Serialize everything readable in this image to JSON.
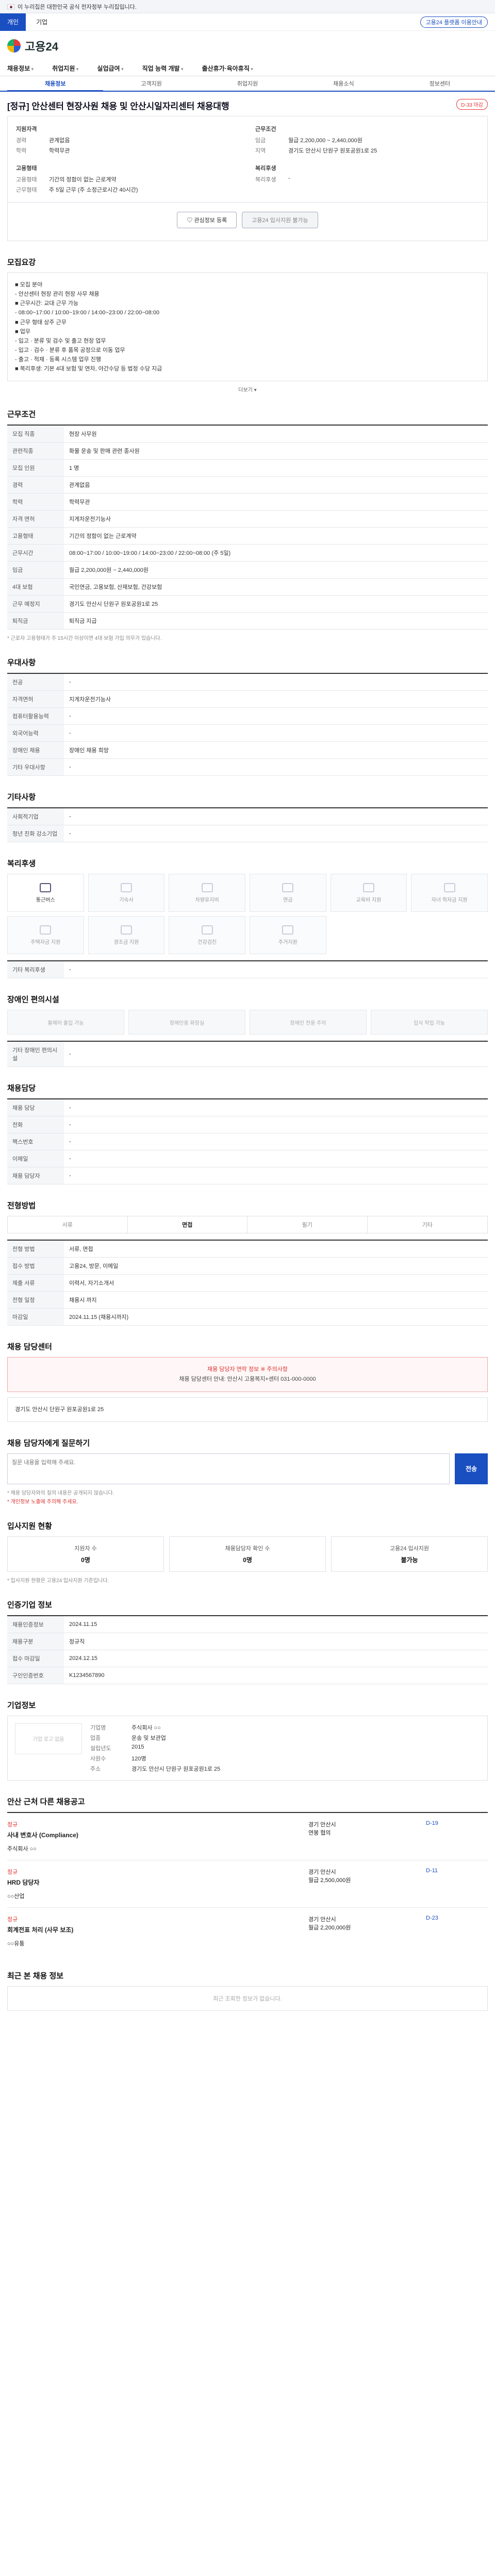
{
  "gov": {
    "text": "이 누리집은 대한민국 공식 전자정부 누리집입니다."
  },
  "top": {
    "personal": "개인",
    "corp": "기업",
    "right_link": "고용24 플랫폼 이용안내"
  },
  "brand": "고용24",
  "gnb": [
    "채용정보",
    "취업지원",
    "실업급여",
    "직업 능력 개발",
    "출산휴가·육아휴직"
  ],
  "tabs": [
    "채용정보",
    "고객지원",
    "취업지원",
    "채용소식",
    "정보센터"
  ],
  "job": {
    "title": "[정규] 안산센터 현장사원 채용 및 안산시일자리센터 채용대행",
    "dday": "D-33 마감"
  },
  "summary": {
    "h1": "지원자격",
    "h2": "근무조건",
    "h3": "고용형태",
    "h4": "복리후생",
    "rows1": [
      [
        "경력",
        "관계없음"
      ],
      [
        "학력",
        "학력무관"
      ]
    ],
    "rows2": [
      [
        "임금",
        "월급 2,200,000 ~ 2,440,000원"
      ],
      [
        "지역",
        "경기도 안산시 단원구 원포공원1로 25"
      ]
    ],
    "rows3": [
      [
        "고용형태",
        "기간의 정함이 없는 근로계약"
      ],
      [
        "근무형태",
        "주 5일 근무 (주 소정근로시간 40시간)"
      ]
    ],
    "rows4": [
      [
        "복리후생",
        "-"
      ]
    ]
  },
  "buttons": {
    "fav": "관심정보 등록",
    "apply": "고용24 입사지원 불가능"
  },
  "s_job": {
    "h": "모집요강",
    "lines": [
      "■ 모집 분야",
      "- 안산센터 현장 관리 현장 사무 채용",
      "■ 근무시간: 교대 근무 가능",
      "- 08:00~17:00 / 10:00~19:00 / 14:00~23:00 / 22:00~08:00",
      "■ 근무 형태 상주 근무",
      "■ 업무",
      "- 입고 · 분류 및 검수 및 출고 현장 업무",
      "- 입고 · 검수 · 분류 후 품목 공정으로 이동 업무",
      "- 출고 · 적재 · 등록 시스템 업무 진행",
      "■ 복리후생: 기본 4대 보험 및 연차, 야간수당 등 법정 수당 지급"
    ],
    "more": "더보기 ▾"
  },
  "s_cond": {
    "h": "근무조건",
    "rows": [
      [
        "모집 직종",
        "현장 사무원"
      ],
      [
        "관련직종",
        "화물 운송 및 판매 관련 종사원"
      ],
      [
        "모집 인원",
        "1 명"
      ],
      [
        "경력",
        "관계없음"
      ],
      [
        "학력",
        "학력무관"
      ],
      [
        "자격 면허",
        "지게차운전기능사"
      ],
      [
        "고용형태",
        "기간의 정함이 없는 근로계약"
      ],
      [
        "근무시간",
        "08:00~17:00 / 10:00~19:00 / 14:00~23:00 / 22:00~08:00 (주 5일)"
      ],
      [
        "임금",
        "월급 2,200,000원 ~ 2,440,000원"
      ],
      [
        "4대 보험",
        "국민연금, 고용보험, 산재보험, 건강보험"
      ],
      [
        "근무 예정지",
        "경기도 안산시 단원구 원포공원1로 25"
      ],
      [
        "퇴직금",
        "퇴직금 지급"
      ]
    ],
    "note": "* 근로자 고용형태가 주 15시간 이상이면 4대 보험 가입 의무가 있습니다."
  },
  "s_cert": {
    "h": "우대사항",
    "rows": [
      [
        "전공",
        "-"
      ],
      [
        "자격면허",
        "지게차운전기능사"
      ],
      [
        "컴퓨터활용능력",
        "-"
      ],
      [
        "외국어능력",
        "-"
      ],
      [
        "장애인 채용",
        "장애인 채용 희망"
      ],
      [
        "기타 우대사항",
        "-"
      ]
    ]
  },
  "s_etc": {
    "h": "기타사항",
    "rows": [
      [
        "사회적기업",
        "-"
      ],
      [
        "청년 친화 강소기업",
        "-"
      ]
    ]
  },
  "s_welfare": {
    "h": "복리후생",
    "items": [
      "통근버스",
      "기숙사",
      "차량유지비",
      "연금",
      "교육비 지원",
      "자녀 학자금 지원",
      "주택자금 지원",
      "경조금 지원",
      "건강검진",
      "주거지원"
    ],
    "extra": "기타 복리후생",
    "extra_val": "-"
  },
  "s_disab": {
    "h": "장애인 편의시설",
    "items": [
      "휠체어 출입 가능",
      "장애인용 화장실",
      "장애인 전용 주차",
      "입식 작업 가능"
    ],
    "extra": "기타 장애인 편의시설",
    "extra_val": "-"
  },
  "s_contact": {
    "h": "채용담당",
    "rows": [
      [
        "채용 담당",
        "-"
      ],
      [
        "전화",
        "-"
      ],
      [
        "팩스번호",
        "-"
      ],
      [
        "이메일",
        "-"
      ],
      [
        "채용 담당자",
        "-"
      ]
    ]
  },
  "s_apply": {
    "h": "전형방법",
    "tabs": [
      "서류",
      "면접",
      "필기",
      "기타"
    ],
    "rows": [
      [
        "전형 방법",
        "서류, 면접"
      ],
      [
        "접수 방법",
        "고용24, 방문, 이메일"
      ],
      [
        "제출 서류",
        "이력서, 자기소개서"
      ],
      [
        "전형 일정",
        "채용시 까지"
      ],
      [
        "마감일",
        "2024.11.15 (채용시까지)"
      ]
    ]
  },
  "s_center": {
    "h": "채용 담당센터",
    "alert": "채용 담당자 연락 정보 ※ 주의사항",
    "alert2": "채용 담당센터 안내: 안산시 고용복지+센터 031-000-0000",
    "center": "경기도 안산시 단원구 원포공원1로 25"
  },
  "s_qa": {
    "h": "채용 담당자에게 질문하기",
    "placeholder": "질문 내용을 입력해 주세요.",
    "send": "전송",
    "notes": [
      "* 채용 담당자와의 질의 내용은 공개되지 않습니다.",
      "* 개인정보 노출에 주의해 주세요."
    ]
  },
  "s_stat": {
    "h": "입사지원 현황",
    "items": [
      [
        "지원자 수",
        "0명"
      ],
      [
        "채용담당자 확인 수",
        "0명"
      ],
      [
        "고용24 입사지원",
        "불가능"
      ]
    ],
    "note": "* 입사지원 현황은 고용24 입사지원 기준입니다."
  },
  "s_info": {
    "h": "인증기업 정보",
    "rows": [
      [
        "채용인증정보",
        "2024.11.15"
      ],
      [
        "채용구분",
        "정규직"
      ],
      [
        "접수 마감일",
        "2024.12.15"
      ],
      [
        "구인인증번호",
        "K1234567890"
      ]
    ]
  },
  "s_ent": {
    "h": "기업정보",
    "logo": "기업 로고 없음",
    "rows": [
      [
        "기업명",
        "주식회사 ○○"
      ],
      [
        "업종",
        "운송 및 보관업"
      ],
      [
        "설립년도",
        "2015"
      ],
      [
        "사원수",
        "120명"
      ],
      [
        "주소",
        "경기도 안산시 단원구 원포공원1로 25"
      ]
    ]
  },
  "s_rec": {
    "h": "안산 근처 다른 채용공고",
    "jobs": [
      {
        "tag": "정규",
        "title": "사내 변호사 (Compliance)",
        "company": "주식회사 ○○",
        "loc": "경기 안산시",
        "pay": "연봉 협의",
        "dday": "D-19"
      },
      {
        "tag": "정규",
        "title": "HRD 담당자",
        "company": "○○산업",
        "loc": "경기 안산시",
        "pay": "월급 2,500,000원",
        "dday": "D-11"
      },
      {
        "tag": "정규",
        "title": "회계전표 처리 (사무 보조)",
        "company": "○○유통",
        "loc": "경기 안산시",
        "pay": "월급 2,200,000원",
        "dday": "D-23"
      }
    ]
  },
  "s_recent": {
    "h": "최근 본 채용 정보",
    "empty": "최근 조회한 정보가 없습니다."
  }
}
